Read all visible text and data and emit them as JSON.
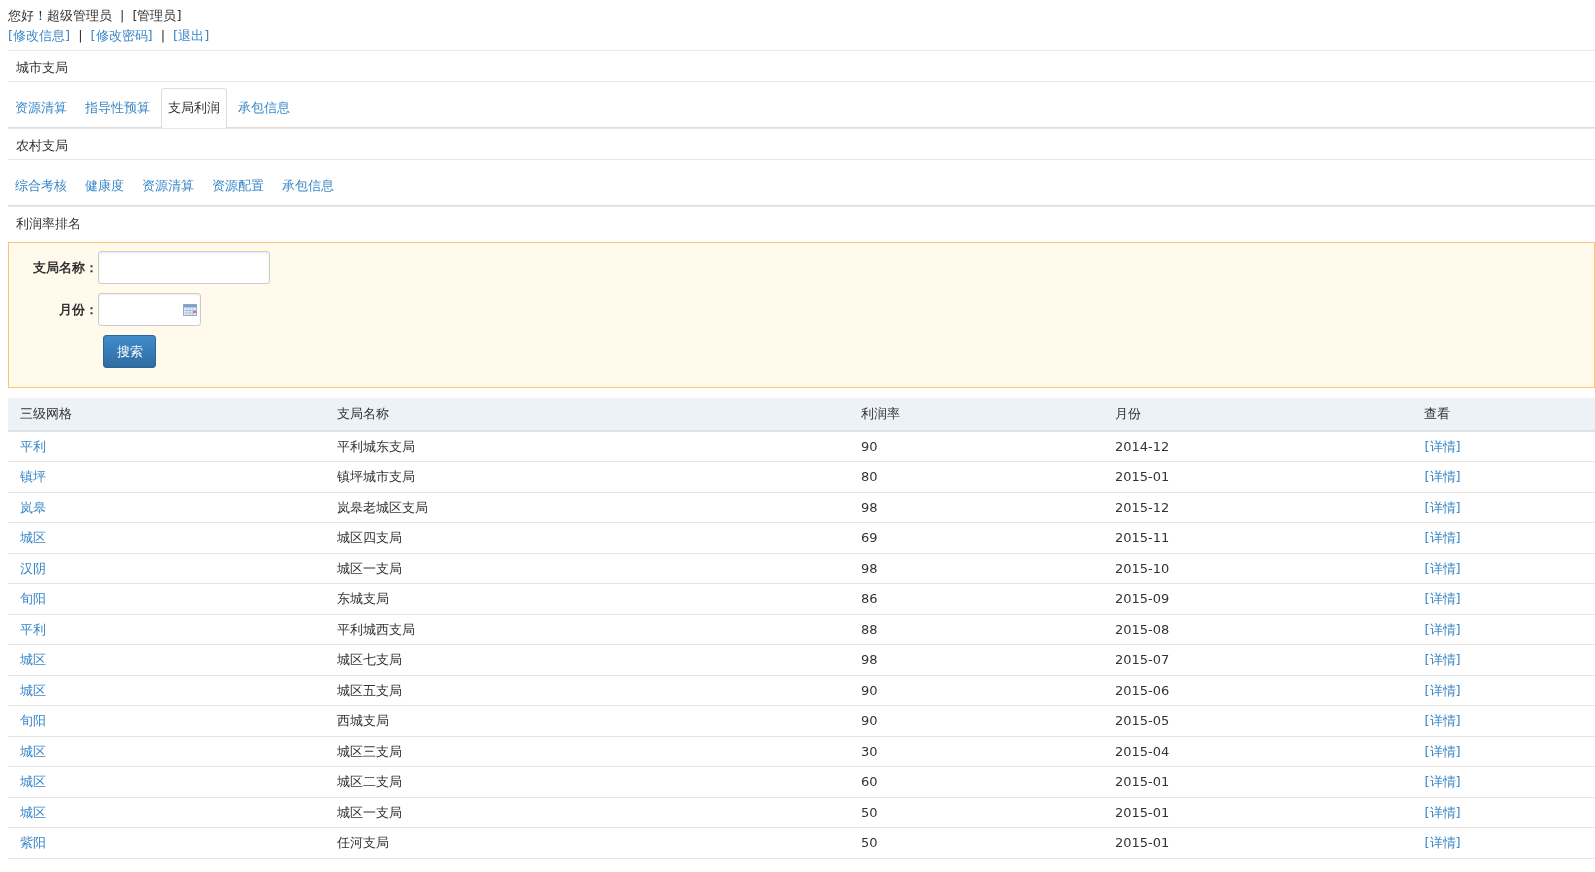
{
  "header": {
    "greeting": "您好！超级管理员",
    "separator": "|",
    "role": "[管理员]",
    "links": [
      "[修改信息]",
      "[修改密码]",
      "[退出]"
    ]
  },
  "sections": [
    {
      "title": "城市支局",
      "tabs": [
        {
          "label": "资源清算",
          "selected": false
        },
        {
          "label": "指导性预算",
          "selected": false
        },
        {
          "label": "支局利润",
          "selected": true
        },
        {
          "label": "承包信息",
          "selected": false
        }
      ]
    },
    {
      "title": "农村支局",
      "tabs": [
        {
          "label": "综合考核",
          "selected": false
        },
        {
          "label": "健康度",
          "selected": false
        },
        {
          "label": "资源清算",
          "selected": false
        },
        {
          "label": "资源配置",
          "selected": false
        },
        {
          "label": "承包信息",
          "selected": false
        }
      ]
    }
  ],
  "page_title": "利润率排名",
  "search_form": {
    "fields": [
      {
        "label": "支局名称：",
        "kind": "text"
      },
      {
        "label": "月份：",
        "kind": "date"
      }
    ],
    "button": "搜索"
  },
  "table": {
    "columns": [
      "三级网格",
      "支局名称",
      "利润率",
      "月份",
      "查看"
    ],
    "rows": [
      [
        "平利",
        "平利城东支局",
        "90",
        "2014-12",
        "[详情]"
      ],
      [
        "镇坪",
        "镇坪城市支局",
        "80",
        "2015-01",
        "[详情]"
      ],
      [
        "岚皋",
        "岚皋老城区支局",
        "98",
        "2015-12",
        "[详情]"
      ],
      [
        "城区",
        "城区四支局",
        "69",
        "2015-11",
        "[详情]"
      ],
      [
        "汉阴",
        "城区一支局",
        "98",
        "2015-10",
        "[详情]"
      ],
      [
        "旬阳",
        "东城支局",
        "86",
        "2015-09",
        "[详情]"
      ],
      [
        "平利",
        "平利城西支局",
        "88",
        "2015-08",
        "[详情]"
      ],
      [
        "城区",
        "城区七支局",
        "98",
        "2015-07",
        "[详情]"
      ],
      [
        "城区",
        "城区五支局",
        "90",
        "2015-06",
        "[详情]"
      ],
      [
        "旬阳",
        "西城支局",
        "90",
        "2015-05",
        "[详情]"
      ],
      [
        "城区",
        "城区三支局",
        "30",
        "2015-04",
        "[详情]"
      ],
      [
        "城区",
        "城区二支局",
        "60",
        "2015-01",
        "[详情]"
      ],
      [
        "城区",
        "城区一支局",
        "50",
        "2015-01",
        "[详情]"
      ],
      [
        "紫阳",
        "任河支局",
        "50",
        "2015-01",
        "[详情]"
      ]
    ]
  }
}
